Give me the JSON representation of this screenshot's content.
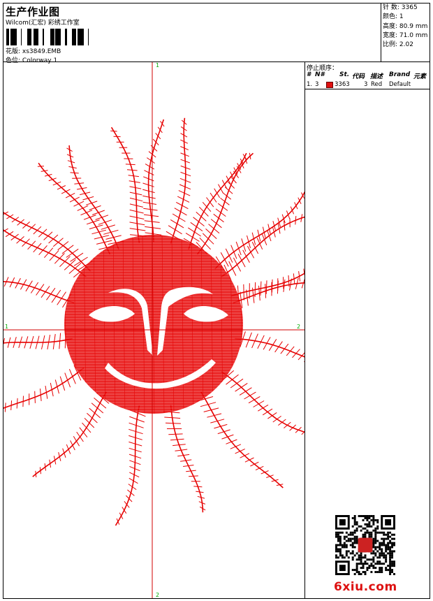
{
  "header": {
    "title": "生产作业图",
    "studio": "Wilcom(汇宏) 彩绣工作室",
    "design_label": "花版:",
    "design_value": "xs3849.EMB",
    "colorway_label": "色位:",
    "colorway_value": "Colorway 1"
  },
  "stats": [
    {
      "label": "针 数",
      "value": "3365"
    },
    {
      "label": "颜色",
      "value": "1"
    },
    {
      "label": "高度",
      "value": "80.9 mm"
    },
    {
      "label": "宽度",
      "value": "71.0 mm"
    },
    {
      "label": "比例",
      "value": "2.02"
    }
  ],
  "stops": {
    "title": "停止顺序：",
    "headers": {
      "num": "#",
      "n": "N#",
      "st": "St.",
      "code": "代码",
      "desc": "描述",
      "brand": "Brand",
      "element": "元素"
    },
    "rows": [
      {
        "num": "1.",
        "n": "3",
        "color": "#e01010",
        "st": "3363",
        "code": "3",
        "desc": "Red",
        "brand": "Default"
      }
    ]
  },
  "axes": {
    "top": "1",
    "bottom": "2",
    "left": "1",
    "right": "2"
  },
  "colors": {
    "stitch": "#e60000",
    "axis": "#d00000",
    "watermark": "#d11111"
  },
  "watermark": "6xiu.com"
}
